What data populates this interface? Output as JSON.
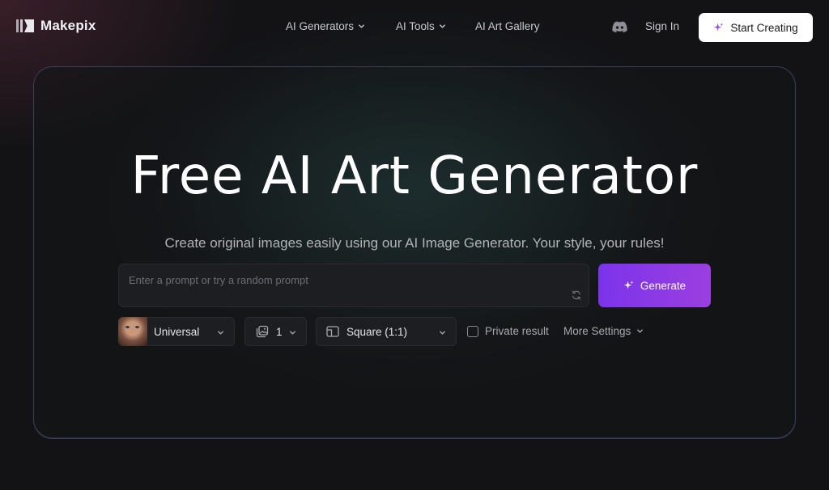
{
  "brand": {
    "name": "Makepix"
  },
  "nav": {
    "items": [
      {
        "label": "AI Generators"
      },
      {
        "label": "AI Tools"
      },
      {
        "label": "AI Art Gallery"
      }
    ],
    "sign_in": "Sign In",
    "start_creating": "Start Creating"
  },
  "hero": {
    "title": "Free AI Art Generator",
    "subtitle": "Create original images easily using our AI Image Generator. Your style, your rules!"
  },
  "prompt": {
    "value": "",
    "placeholder": "Enter a prompt or try a random prompt"
  },
  "generate_label": "Generate",
  "controls": {
    "model": "Universal",
    "count": "1",
    "aspect_ratio": "Square (1:1)",
    "private_label": "Private result",
    "private_checked": false,
    "more_settings": "More Settings"
  },
  "icons": [
    "logo-icon",
    "chevron-down-icon",
    "discord-icon",
    "sparkle-icon",
    "refresh-icon",
    "image-icon",
    "aspect-ratio-icon",
    "checkbox"
  ],
  "colors": {
    "accent_start": "#7b34ea",
    "accent_end": "#9b3fe0",
    "background": "#131316",
    "card_border": "#3b3f5a"
  }
}
